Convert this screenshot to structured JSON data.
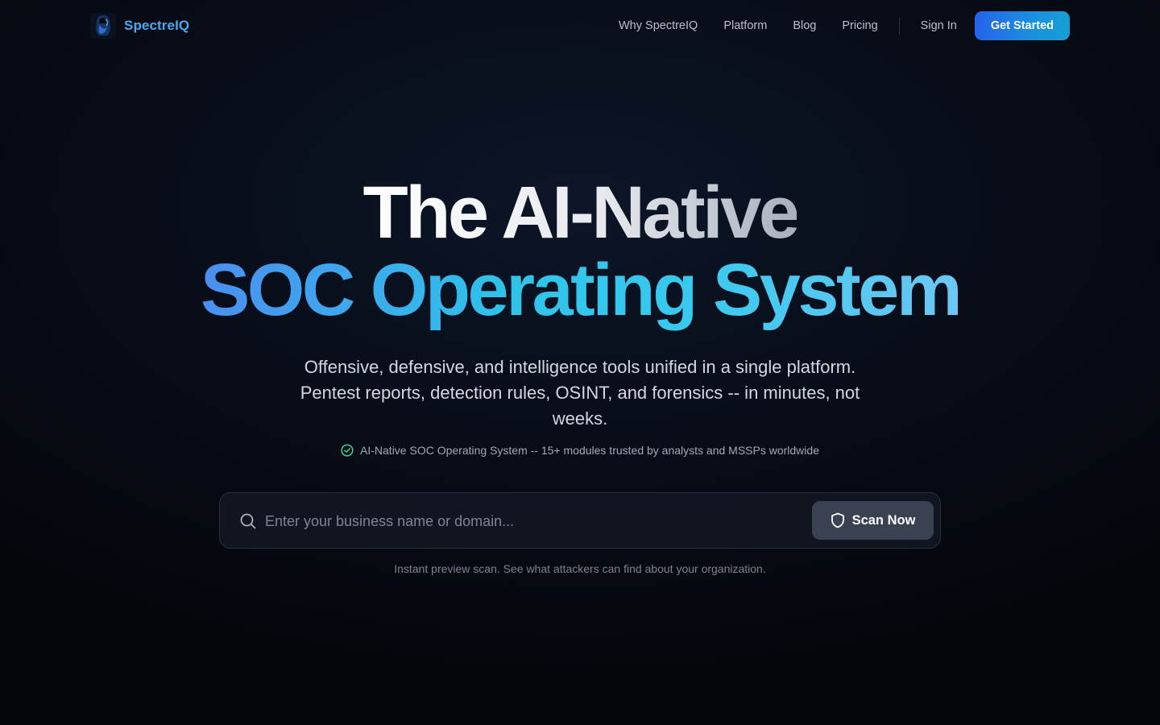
{
  "brand": {
    "name": "SpectreIQ",
    "logo_icon": "hooded-figure-logo"
  },
  "nav": {
    "links": [
      "Why SpectreIQ",
      "Platform",
      "Blog",
      "Pricing"
    ],
    "sign_in": "Sign In",
    "cta": "Get Started"
  },
  "hero": {
    "title_line1": "The AI-Native",
    "title_line2": "SOC Operating System",
    "subtitle": "Offensive, defensive, and intelligence tools unified in a single platform. Pentest reports, detection rules, OSINT, and forensics -- in minutes, not weeks.",
    "trust_text": "AI-Native SOC Operating System -- 15+ modules trusted by analysts and MSSPs worldwide",
    "trust_icon": "check-circle-icon"
  },
  "search": {
    "placeholder": "Enter your business name or domain...",
    "value": "",
    "button_label": "Scan Now",
    "button_icon": "shield-icon",
    "hint": "Instant preview scan. See what attackers can find about your organization."
  },
  "colors": {
    "accent_blue": "#2563eb",
    "brand_text": "#4aa8f2",
    "check_green": "#34d399",
    "background": "#070c16"
  }
}
